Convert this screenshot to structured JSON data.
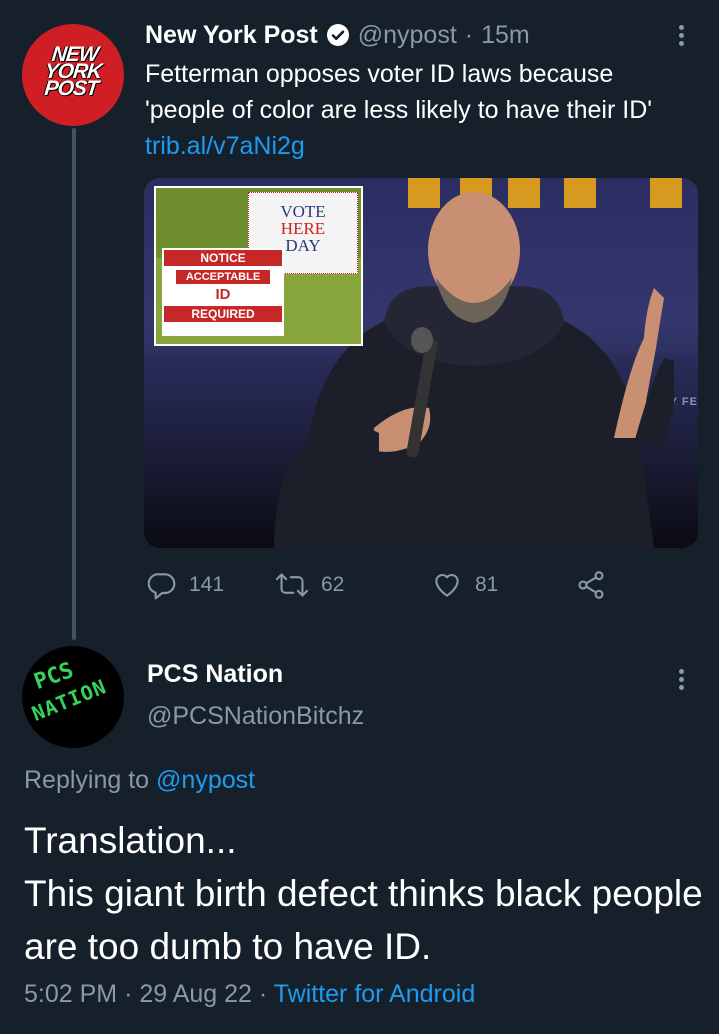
{
  "tweet1": {
    "avatar_text": [
      "NEW",
      "YORK",
      "POST"
    ],
    "name": "New York Post",
    "handle": "@nypost",
    "separator": "·",
    "time": "15m",
    "text": "Fetterman opposes voter ID laws because 'people of color are less likely to have their ID'",
    "link": "trib.al/v7aNi2g",
    "media": {
      "sign_vote": [
        "VOTE",
        "HERE",
        "DAY"
      ],
      "sign_notice": [
        "NOTICE",
        "ACCEPTABLE",
        "ID",
        "REQUIRED"
      ],
      "stage_text": "D FOR BY FE"
    },
    "actions": {
      "replies": "141",
      "retweets": "62",
      "likes": "81"
    }
  },
  "tweet2": {
    "avatar_text": [
      "PCS",
      "NATION"
    ],
    "name": "PCS Nation",
    "handle": "@PCSNationBitchz",
    "replying_prefix": "Replying to",
    "replying_handle": "@nypost",
    "text_line1": "Translation...",
    "text_line2": "This giant birth defect thinks black people are too dumb to have ID.",
    "time": "5:02 PM",
    "date": "29 Aug 22",
    "source": "Twitter for Android",
    "separator": "·"
  },
  "colors": {
    "background": "#15202b",
    "secondary_text": "#8b98a5",
    "link": "#1d9bf0",
    "nypost_red": "#cf1f25",
    "pcs_green": "#36d35a"
  }
}
